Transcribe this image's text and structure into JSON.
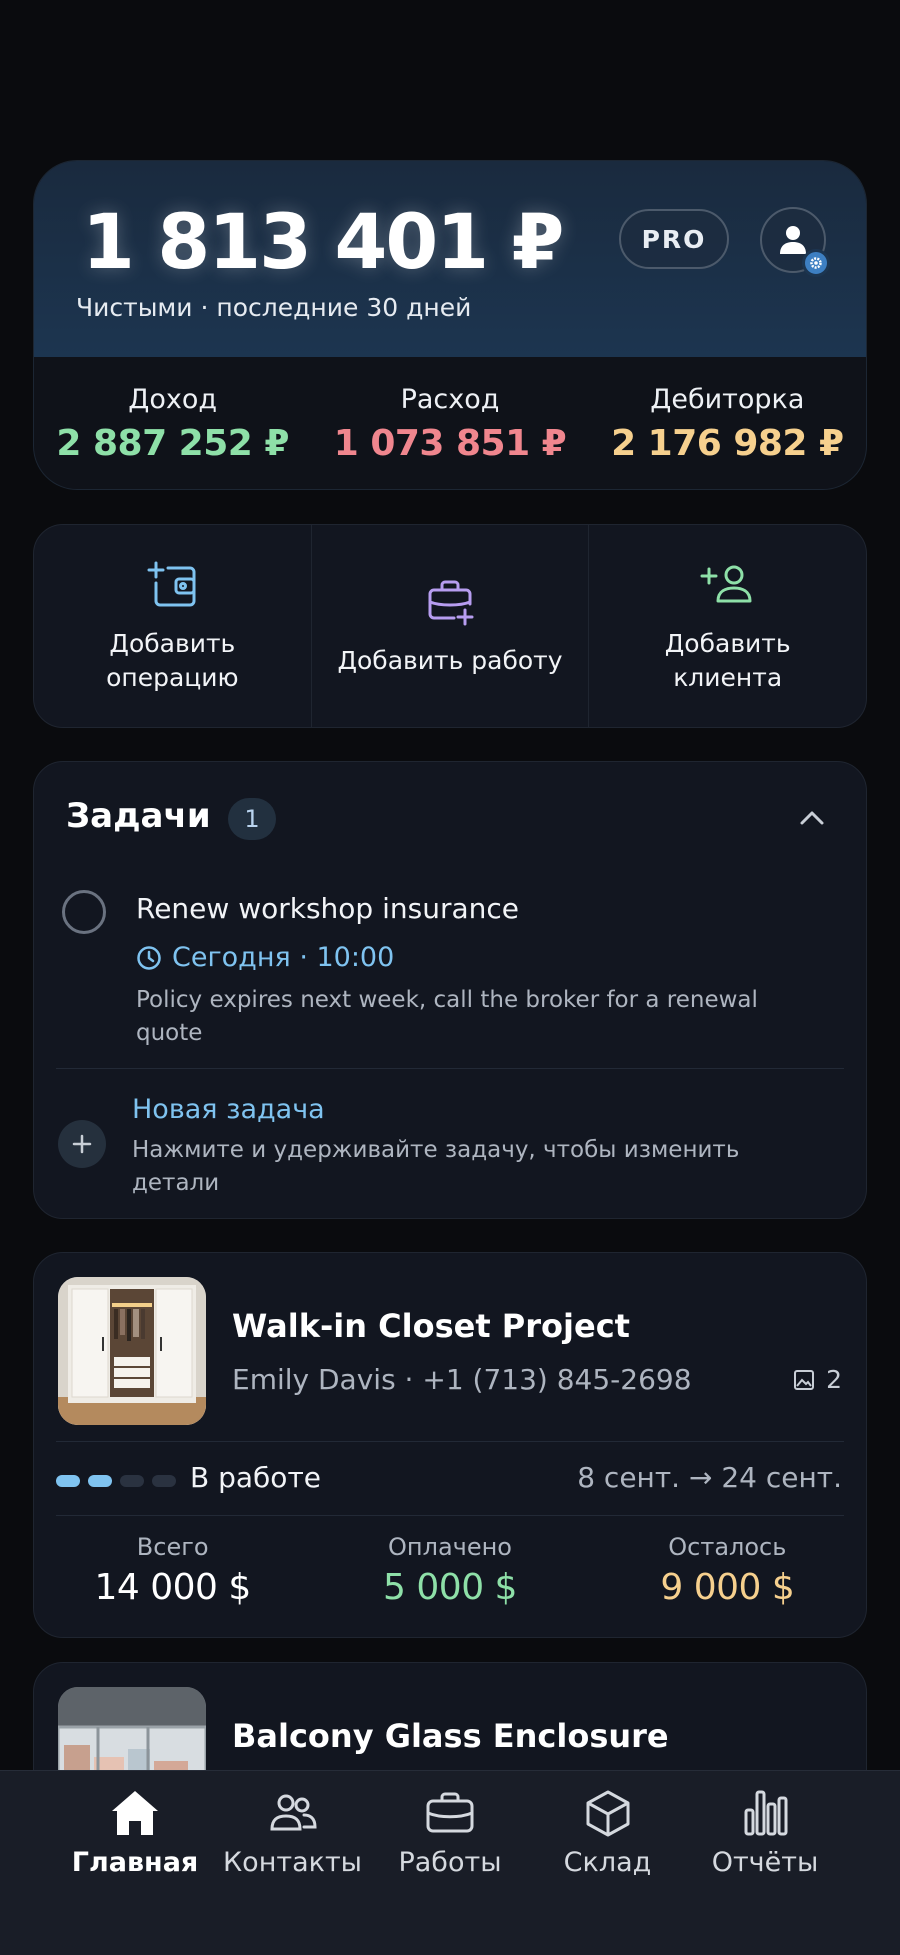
{
  "summary": {
    "balance": "1 813 401 ₽",
    "subtitle": "Чистыми · последние 30 дней",
    "pro_badge": "PRO",
    "stats": [
      {
        "label": "Доход",
        "value": "2 887 252 ₽",
        "color": "#8ee0a8"
      },
      {
        "label": "Расход",
        "value": "1 073 851 ₽",
        "color": "#f0868e"
      },
      {
        "label": "Дебиторка",
        "value": "2 176 982 ₽",
        "color": "#f6d08e"
      }
    ]
  },
  "actions": [
    {
      "label": "Добавить операцию",
      "icon": "add-operation-icon",
      "color": "#7fc3f0"
    },
    {
      "label": "Добавить работу",
      "icon": "add-job-icon",
      "color": "#b79df0"
    },
    {
      "label": "Добавить клиента",
      "icon": "add-client-icon",
      "color": "#8ee0a8"
    }
  ],
  "tasks": {
    "title": "Задачи",
    "count": "1",
    "items": [
      {
        "title": "Renew workshop insurance",
        "time": "Сегодня · 10:00",
        "description": "Policy expires next week, call the broker for a renewal quote"
      }
    ],
    "new_task_label": "Новая задача",
    "new_task_hint": "Нажмите и удерживайте задачу, чтобы изменить детали"
  },
  "projects": [
    {
      "title": "Walk-in Closet Project",
      "client": "Emily Davis  · +1 (713) 845-2698",
      "photo_count": "2",
      "progress_steps_done": 2,
      "progress_steps_total": 4,
      "status": "В работе",
      "dates": "8 сент. → 24 сент.",
      "totals": [
        {
          "label": "Всего",
          "value": "14 000 $",
          "color": "#ffffff"
        },
        {
          "label": "Оплачено",
          "value": "5 000 $",
          "color": "#8ee0a8"
        },
        {
          "label": "Осталось",
          "value": "9 000 $",
          "color": "#f6d08e"
        }
      ]
    },
    {
      "title": "Balcony Glass Enclosure"
    }
  ],
  "tabbar": {
    "active": "home",
    "tabs": [
      {
        "id": "home",
        "label": "Главная",
        "icon": "home-icon"
      },
      {
        "id": "contacts",
        "label": "Контакты",
        "icon": "contacts-icon"
      },
      {
        "id": "jobs",
        "label": "Работы",
        "icon": "briefcase-icon"
      },
      {
        "id": "stock",
        "label": "Склад",
        "icon": "box-icon"
      },
      {
        "id": "reports",
        "label": "Отчёты",
        "icon": "bar-chart-icon"
      }
    ]
  }
}
